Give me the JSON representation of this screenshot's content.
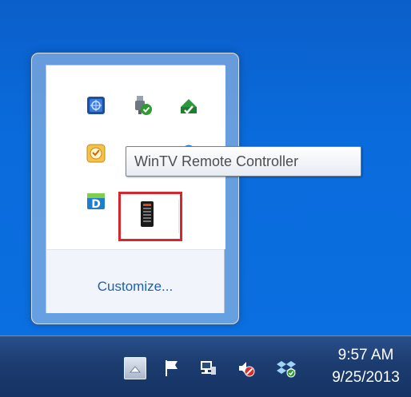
{
  "tooltip": {
    "text": "WinTV Remote Controller"
  },
  "popup": {
    "customize_label": "Customize..."
  },
  "clock": {
    "time": "9:57 AM",
    "date": "9/25/2013"
  },
  "icons": {
    "row1": [
      "network-adapter-icon",
      "usb-safely-remove-icon",
      "green-upload-icon"
    ],
    "row2": [
      "yellow-clock-icon",
      "partially-hidden-icon-1",
      "partially-hidden-icon-2"
    ],
    "row3": [
      "daemon-tools-icon",
      "wintv-remote-controller-icon"
    ],
    "taskbar": [
      "show-hidden-icons-arrow-icon",
      "action-center-flag-icon",
      "network-icon",
      "volume-muted-icon",
      "dropbox-icon"
    ]
  },
  "colors": {
    "highlight": "#d8262f",
    "link": "#1c61b5",
    "desktop": "#0a66d3"
  }
}
